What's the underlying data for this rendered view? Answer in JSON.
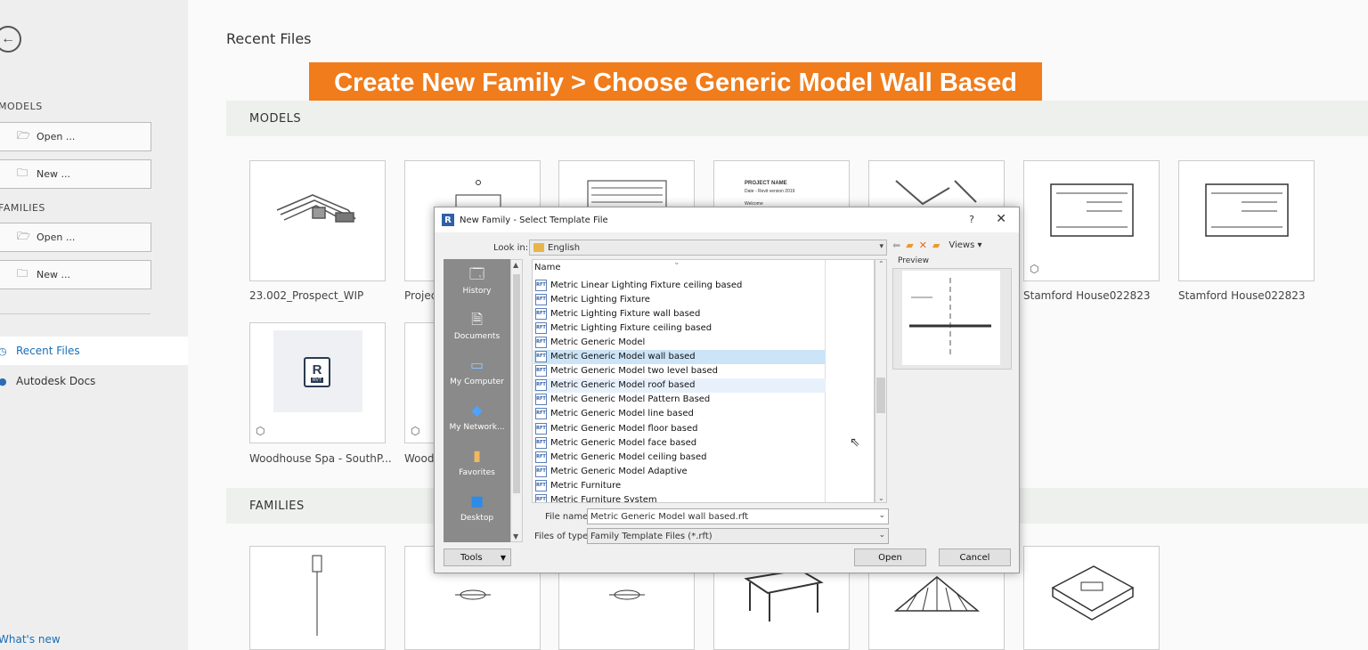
{
  "sidebar": {
    "models_heading": "MODELS",
    "models_open": "Open ...",
    "models_new": "New ...",
    "families_heading": "FAMILIES",
    "families_open": "Open ...",
    "families_new": "New ...",
    "recent_files": "Recent Files",
    "autodesk_docs": "Autodesk Docs",
    "whats_new": "What's new"
  },
  "main": {
    "title": "Recent Files",
    "banner": "Create New Family > Choose Generic Model Wall Based",
    "models_section": "MODELS",
    "families_section": "FAMILIES",
    "model_thumbs": [
      {
        "label": "23.002_Prospect_WIP"
      },
      {
        "label": "Projec"
      },
      {
        "label": ""
      },
      {
        "label": "",
        "caption_title": "PROJECT NAME",
        "caption_sub": "Date - Revit version 2019",
        "caption_extra": "Welcome"
      },
      {
        "label": ""
      },
      {
        "label": "Stamford House022823"
      },
      {
        "label": "Stamford House022823"
      }
    ],
    "model_thumbs_row2": [
      {
        "label": "Woodhouse Spa - SouthP...",
        "badge": "RVT"
      },
      {
        "label": "Wood"
      }
    ]
  },
  "dialog": {
    "title": "New Family - Select Template File",
    "help": "?",
    "close": "✕",
    "look_in_label": "Look in:",
    "look_in_value": "English",
    "views_label": "Views",
    "preview_label": "Preview",
    "column_name": "Name",
    "places": [
      "History",
      "Documents",
      "My Computer",
      "My Network...",
      "Favorites",
      "Desktop"
    ],
    "files": [
      "Metric Linear Lighting Fixture ceiling based",
      "Metric Lighting Fixture",
      "Metric Lighting Fixture wall based",
      "Metric Lighting Fixture ceiling based",
      "Metric Generic Model",
      "Metric Generic Model wall based",
      "Metric Generic Model two level based",
      "Metric Generic Model roof based",
      "Metric Generic Model Pattern Based",
      "Metric Generic Model line based",
      "Metric Generic Model floor based",
      "Metric Generic Model face based",
      "Metric Generic Model ceiling based",
      "Metric Generic Model Adaptive",
      "Metric Furniture",
      "Metric Furniture System"
    ],
    "selected_index": 5,
    "hover_index": 7,
    "file_name_label": "File name:",
    "file_name_value": "Metric Generic Model wall based.rft",
    "files_of_type_label": "Files of type:",
    "files_of_type_value": "Family Template Files  (*.rft)",
    "tools_label": "Tools",
    "open_label": "Open",
    "cancel_label": "Cancel",
    "rft_icon_text": "RFT"
  }
}
